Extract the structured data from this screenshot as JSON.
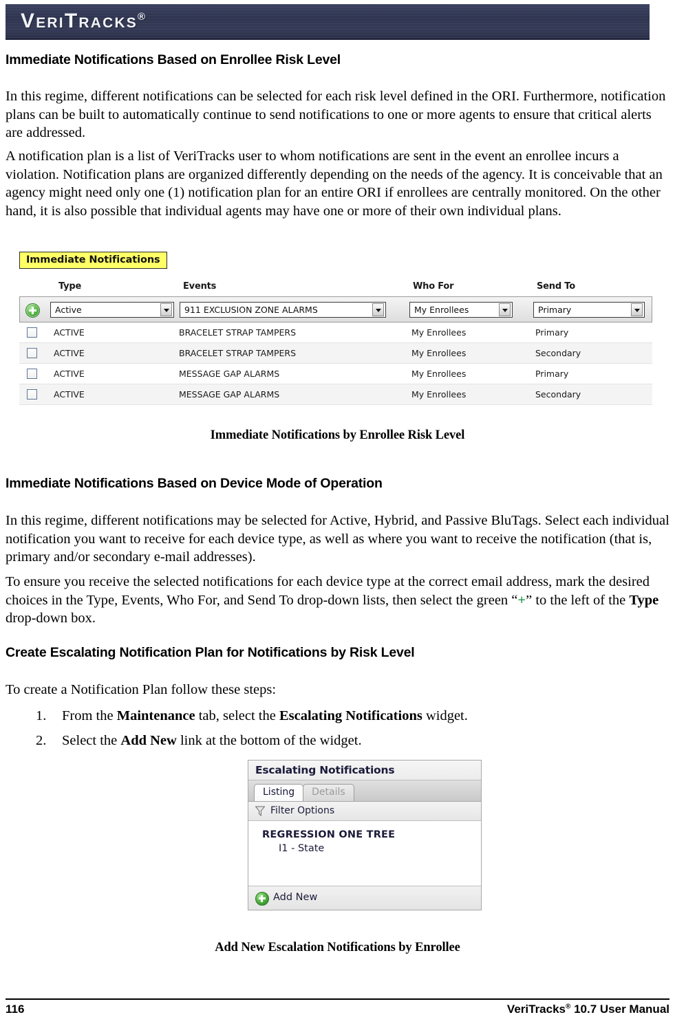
{
  "banner": {
    "logo_text": "VeriTracks",
    "logo_registered": "®"
  },
  "sections": {
    "heading1": "Immediate Notifications Based on Enrollee Risk Level",
    "para1": "In this regime, different notifications can be selected for each risk level defined in the ORI.  Furthermore, notification plans can be built to automatically continue to send notifications to one or more agents to ensure that critical alerts are addressed.",
    "para2": "A notification plan is a list of VeriTracks user to whom notifications are sent in the event an enrollee incurs a violation.  Notification plans are organized differently depending on the needs of the agency.  It is conceivable that an agency might need only one (1) notification plan for an entire ORI if enrollees are centrally monitored.  On the other hand, it is also possible that individual agents may have one or more of their own individual plans.",
    "caption1": "Immediate Notifications by Enrollee Risk Level",
    "heading2": "Immediate Notifications Based on Device Mode of Operation",
    "para3": "In this regime, different notifications may be selected for Active, Hybrid, and Passive BluTags.  Select each individual notification you want to receive for each device type, as well as where you want to receive the notification (that is, primary and/or secondary e-mail addresses).",
    "para4_part1": "To ensure you receive the selected notifications for each device type at the correct email address, mark the desired choices in the Type, Events, Who For, and Send To drop-down lists, then select the green “",
    "para4_plus": "+",
    "para4_part2": "” to the left of the ",
    "para4_bold": "Type",
    "para4_part3": " drop-down box.",
    "heading3": "Create Escalating Notification Plan for Notifications by Risk Level",
    "para5": "To create a Notification Plan follow these steps:",
    "caption2": "Add New Escalation Notifications by Enrollee"
  },
  "steps": [
    {
      "number": "1.",
      "pre": "From the ",
      "bold1": "Maintenance",
      "mid": " tab, select the ",
      "bold2": "Escalating Notifications",
      "post": " widget."
    },
    {
      "number": "2.",
      "pre": "Select the ",
      "bold1": "Add New",
      "mid": " link at the bottom of the widget.",
      "bold2": "",
      "post": ""
    }
  ],
  "immediate_notifications_widget": {
    "title": "Immediate Notifications",
    "title_highlight_color": "#ffff66",
    "add_icon": "green-plus-icon",
    "columns": [
      "Type",
      "Events",
      "Who For",
      "Send To"
    ],
    "filters": {
      "type_value": "Active",
      "events_value": "911 EXCLUSION ZONE ALARMS",
      "who_for_value": "My Enrollees",
      "send_to_value": "Primary"
    },
    "rows": [
      {
        "type": "ACTIVE",
        "events": "BRACELET STRAP TAMPERS",
        "who_for": "My Enrollees",
        "send_to": "Primary"
      },
      {
        "type": "ACTIVE",
        "events": "BRACELET STRAP TAMPERS",
        "who_for": "My Enrollees",
        "send_to": "Secondary"
      },
      {
        "type": "ACTIVE",
        "events": "MESSAGE GAP ALARMS",
        "who_for": "My Enrollees",
        "send_to": "Primary"
      },
      {
        "type": "ACTIVE",
        "events": "MESSAGE GAP ALARMS",
        "who_for": "My Enrollees",
        "send_to": "Secondary"
      }
    ]
  },
  "escalating_notifications_widget": {
    "title": "Escalating Notifications",
    "tabs": [
      {
        "label": "Listing",
        "active": true
      },
      {
        "label": "Details",
        "active": false
      }
    ],
    "filter_label": "Filter Options",
    "filter_icon": "funnel-icon",
    "tree_root": "REGRESSION ONE TREE",
    "tree_child": "I1 - State",
    "add_new_label": "Add New",
    "add_new_icon": "green-plus-icon"
  },
  "footer": {
    "page_number": "116",
    "manual_name": "VeriTracks",
    "manual_registered": "®",
    "manual_version": " 10.7 User Manual"
  }
}
